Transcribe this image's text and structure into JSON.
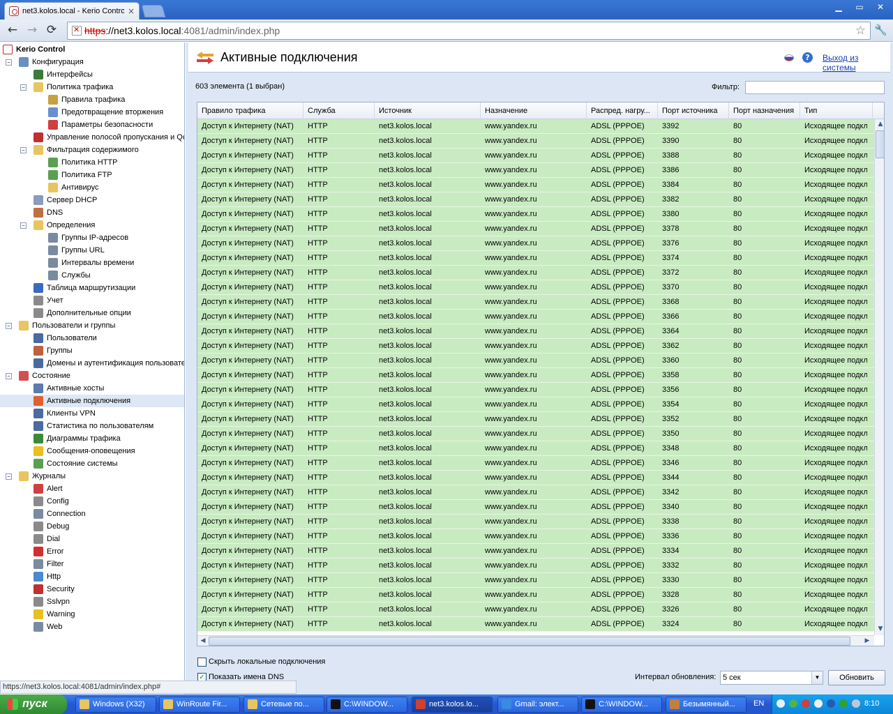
{
  "browser": {
    "tab_title": "net3.kolos.local - Kerio Contro",
    "tab_close": "×",
    "url_scheme": "https",
    "url_host": "://net3.kolos.local",
    "url_rest": ":4081/admin/index.php",
    "status_url": "https://net3.kolos.local:4081/admin/index.php#",
    "back": "←",
    "forward": "→",
    "reload": "⟳",
    "star": "☆",
    "minimize": "▁",
    "restore": "▭",
    "close": "✕",
    "wrench": "🔧"
  },
  "tree": {
    "root": "Kerio Control",
    "items": [
      {
        "label": "Конфигурация",
        "level": 1,
        "toggle": "−",
        "icon": "config-icon",
        "color": "#6a8fc0"
      },
      {
        "label": "Интерфейсы",
        "level": 2,
        "icon": "interfaces-icon",
        "color": "#3a7a3a"
      },
      {
        "label": "Политика трафика",
        "level": 2,
        "toggle": "−",
        "icon": "folder-icon",
        "color": "#e8c560"
      },
      {
        "label": "Правила трафика",
        "level": 3,
        "icon": "traffic-rules-icon",
        "color": "#c8a040"
      },
      {
        "label": "Предотвращение вторжения",
        "level": 3,
        "icon": "shield-icon",
        "color": "#6a8fd0"
      },
      {
        "label": "Параметры безопасности",
        "level": 3,
        "icon": "security-icon",
        "color": "#d04040"
      },
      {
        "label": "Управление полосой пропускания и Qo",
        "level": 2,
        "icon": "bandwidth-icon",
        "color": "#c03030"
      },
      {
        "label": "Фильтрация содержимого",
        "level": 2,
        "toggle": "−",
        "icon": "folder-icon",
        "color": "#e8c560"
      },
      {
        "label": "Политика HTTP",
        "level": 3,
        "icon": "http-policy-icon",
        "color": "#5aa050"
      },
      {
        "label": "Политика FTP",
        "level": 3,
        "icon": "ftp-policy-icon",
        "color": "#5aa050"
      },
      {
        "label": "Антивирус",
        "level": 3,
        "icon": "antivirus-icon",
        "color": "#e8c560"
      },
      {
        "label": "Сервер DHCP",
        "level": 2,
        "icon": "dhcp-icon",
        "color": "#8a9ac0"
      },
      {
        "label": "DNS",
        "level": 2,
        "icon": "dns-icon",
        "color": "#c07040"
      },
      {
        "label": "Определения",
        "level": 2,
        "toggle": "−",
        "icon": "folder-icon",
        "color": "#e8c560"
      },
      {
        "label": "Группы IP-адресов",
        "level": 3,
        "icon": "ip-groups-icon",
        "color": "#7a8aa0"
      },
      {
        "label": "Группы URL",
        "level": 3,
        "icon": "url-groups-icon",
        "color": "#7a8aa0"
      },
      {
        "label": "Интервалы времени",
        "level": 3,
        "icon": "time-intervals-icon",
        "color": "#7a8aa0"
      },
      {
        "label": "Службы",
        "level": 3,
        "icon": "services-icon",
        "color": "#7a8aa0"
      },
      {
        "label": "Таблица маршрутизации",
        "level": 2,
        "icon": "routing-icon",
        "color": "#3a6ac0"
      },
      {
        "label": "Учет",
        "level": 2,
        "icon": "accounting-icon",
        "color": "#8a8a8a"
      },
      {
        "label": "Дополнительные опции",
        "level": 2,
        "icon": "advanced-options-icon",
        "color": "#8a8a8a"
      },
      {
        "label": "Пользователи и группы",
        "level": 1,
        "toggle": "−",
        "icon": "users-folder-icon",
        "color": "#e8c560"
      },
      {
        "label": "Пользователи",
        "level": 2,
        "icon": "user-icon",
        "color": "#4a6aa0"
      },
      {
        "label": "Группы",
        "level": 2,
        "icon": "group-icon",
        "color": "#c06040"
      },
      {
        "label": "Домены и аутентификация пользовате",
        "level": 2,
        "icon": "domains-icon",
        "color": "#4a6aa0"
      },
      {
        "label": "Состояние",
        "level": 1,
        "toggle": "−",
        "icon": "status-folder-icon",
        "color": "#d05050"
      },
      {
        "label": "Активные хосты",
        "level": 2,
        "icon": "active-hosts-icon",
        "color": "#5a7ab0"
      },
      {
        "label": "Активные подключения",
        "level": 2,
        "icon": "active-connections-icon",
        "color": "#e06030",
        "selected": true
      },
      {
        "label": "Клиенты VPN",
        "level": 2,
        "icon": "vpn-icon",
        "color": "#4a6aa0"
      },
      {
        "label": "Статистика по пользователям",
        "level": 2,
        "icon": "user-stats-icon",
        "color": "#4a6aa0"
      },
      {
        "label": "Диаграммы трафика",
        "level": 2,
        "icon": "traffic-charts-icon",
        "color": "#3a8a3a"
      },
      {
        "label": "Сообщения-оповещения",
        "level": 2,
        "icon": "warning-icon",
        "color": "#e8c020"
      },
      {
        "label": "Состояние системы",
        "level": 2,
        "icon": "system-status-icon",
        "color": "#5aa050"
      },
      {
        "label": "Журналы",
        "level": 1,
        "toggle": "−",
        "icon": "logs-folder-icon",
        "color": "#e8c560"
      },
      {
        "label": "Alert",
        "level": 2,
        "icon": "alert-log-icon",
        "color": "#d04040"
      },
      {
        "label": "Config",
        "level": 2,
        "icon": "config-log-icon",
        "color": "#8a8a8a"
      },
      {
        "label": "Connection",
        "level": 2,
        "icon": "connection-log-icon",
        "color": "#7a8aa0"
      },
      {
        "label": "Debug",
        "level": 2,
        "icon": "debug-log-icon",
        "color": "#8a8a8a"
      },
      {
        "label": "Dial",
        "level": 2,
        "icon": "dial-log-icon",
        "color": "#8a8a8a"
      },
      {
        "label": "Error",
        "level": 2,
        "icon": "error-log-icon",
        "color": "#d03030"
      },
      {
        "label": "Filter",
        "level": 2,
        "icon": "filter-log-icon",
        "color": "#7a8aa0"
      },
      {
        "label": "Http",
        "level": 2,
        "icon": "http-log-icon",
        "color": "#4a8ad0"
      },
      {
        "label": "Security",
        "level": 2,
        "icon": "security-log-icon",
        "color": "#c03030"
      },
      {
        "label": "Sslvpn",
        "level": 2,
        "icon": "sslvpn-log-icon",
        "color": "#8a8a8a"
      },
      {
        "label": "Warning",
        "level": 2,
        "icon": "warning-log-icon",
        "color": "#e8c020"
      },
      {
        "label": "Web",
        "level": 2,
        "icon": "web-log-icon",
        "color": "#7a8aa0"
      }
    ]
  },
  "header": {
    "title": "Активные подключения",
    "logout": "Выход из системы",
    "help": "?"
  },
  "toolbar": {
    "count": "603 элемента (1 выбран)",
    "filter_label": "Фильтр:",
    "filter_value": ""
  },
  "table": {
    "columns": [
      "Правило трафика",
      "Служба",
      "Источник",
      "Назначение",
      "Распред. нагру...",
      "Порт источника",
      "Порт назначения",
      "Тип"
    ],
    "rule": "Доступ к Интернету (NAT)",
    "service": "HTTP",
    "source": "net3.kolos.local",
    "destination": "www.yandex.ru",
    "balancing": "ADSL (PPPOE)",
    "dest_port": "80",
    "type": "Исходящее подкл...",
    "source_ports": [
      "3392",
      "3390",
      "3388",
      "3386",
      "3384",
      "3382",
      "3380",
      "3378",
      "3376",
      "3374",
      "3372",
      "3370",
      "3368",
      "3366",
      "3364",
      "3362",
      "3360",
      "3358",
      "3356",
      "3354",
      "3352",
      "3350",
      "3348",
      "3346",
      "3344",
      "3342",
      "3340",
      "3338",
      "3336",
      "3334",
      "3332",
      "3330",
      "3328",
      "3326",
      "3324"
    ]
  },
  "options": {
    "hide_local_label": "Скрыть локальные подключения",
    "hide_local_checked": false,
    "show_dns_label": "Показать имена DNS",
    "show_dns_checked": true,
    "interval_label": "Интервал обновления:",
    "interval_value": "5 сек",
    "refresh_label": "Обновить"
  },
  "taskbar": {
    "start": "пуск",
    "tasks": [
      {
        "label": "Windows (X32)",
        "icon": "folder-icon",
        "color": "#e8c560"
      },
      {
        "label": "WinRoute Fir...",
        "icon": "folder-icon",
        "color": "#e8c560"
      },
      {
        "label": "Сетевые по...",
        "icon": "folder-icon",
        "color": "#e8c560"
      },
      {
        "label": "C:\\WINDOW...",
        "icon": "cmd-icon",
        "color": "#111111"
      },
      {
        "label": "net3.kolos.lo...",
        "icon": "chrome-icon",
        "color": "#d04030",
        "active": true
      },
      {
        "label": "Gmail: элект...",
        "icon": "ie-icon",
        "color": "#3a8ae0"
      },
      {
        "label": "C:\\WINDOW...",
        "icon": "cmd-icon",
        "color": "#111111"
      },
      {
        "label": "Безымянный...",
        "icon": "paint-icon",
        "color": "#c08040"
      }
    ],
    "lang": "EN",
    "clock": "8:10"
  }
}
